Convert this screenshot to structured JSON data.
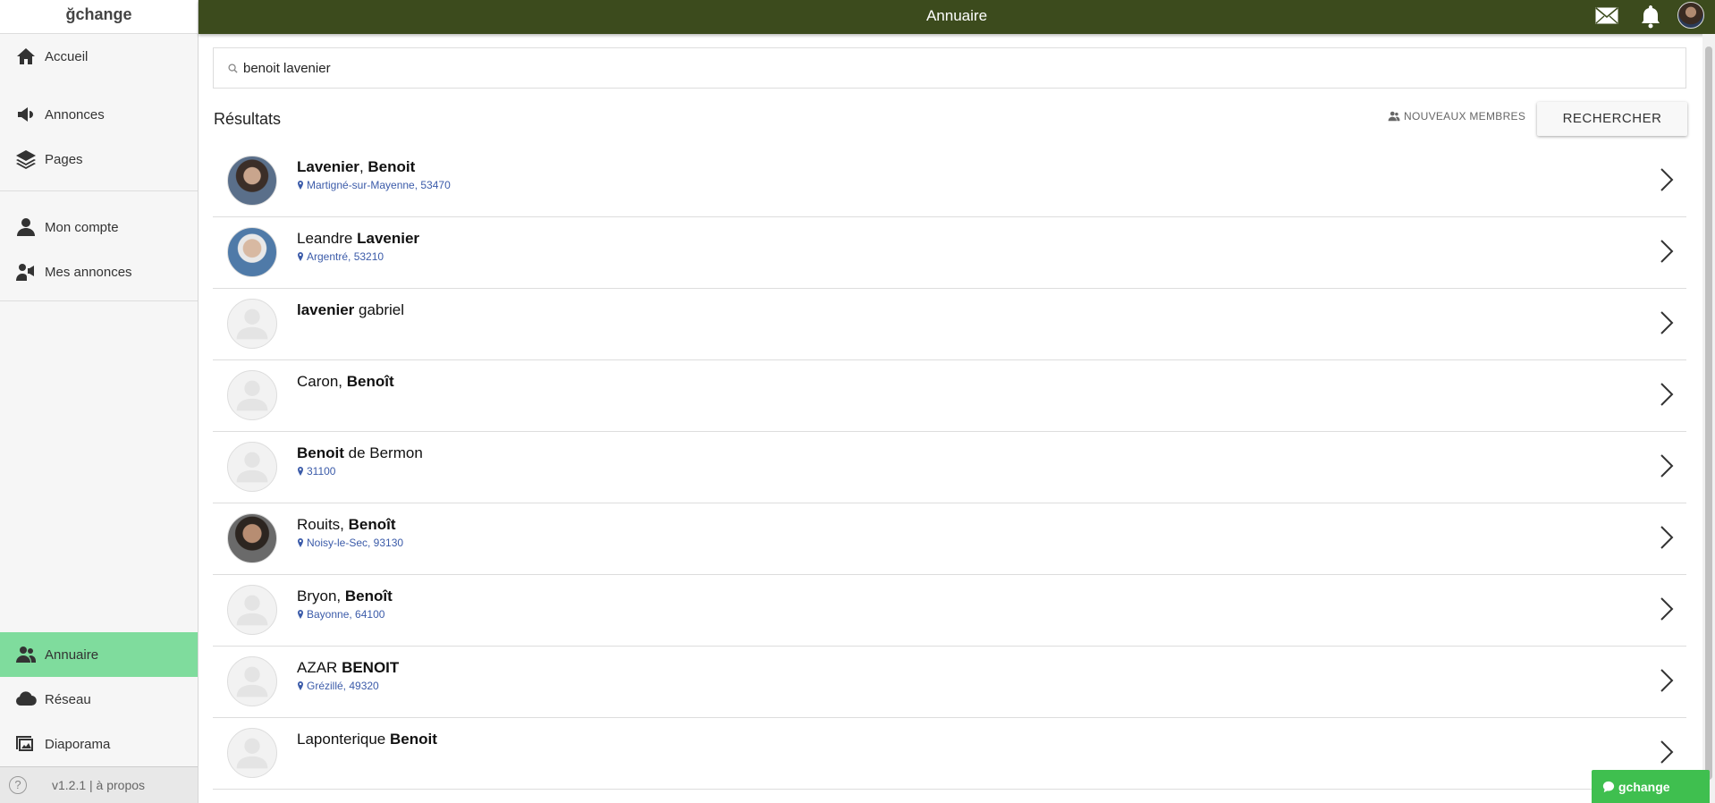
{
  "app": {
    "brand": "ğchange"
  },
  "sidebar": {
    "group1": [
      {
        "label": "Accueil",
        "icon": "home-icon"
      },
      {
        "label": "Annonces",
        "icon": "megaphone-icon"
      },
      {
        "label": "Pages",
        "icon": "layers-icon"
      }
    ],
    "group2": [
      {
        "label": "Mon compte",
        "icon": "person-icon"
      },
      {
        "label": "Mes annonces",
        "icon": "person-megaphone-icon"
      }
    ],
    "bottom": [
      {
        "label": "Annuaire",
        "icon": "people-icon",
        "active": true
      },
      {
        "label": "Réseau",
        "icon": "cloud-icon"
      },
      {
        "label": "Diaporama",
        "icon": "images-icon"
      }
    ],
    "footer": "v1.2.1 | à propos"
  },
  "topbar": {
    "title": "Annuaire"
  },
  "search": {
    "value": "benoit lavenier"
  },
  "results": {
    "heading": "Résultats",
    "new_members": "NOUVEAUX MEMBRES",
    "button": "RECHERCHER",
    "items": [
      {
        "parts": [
          {
            "t": "Lavenier",
            "b": true
          },
          {
            "t": ", ",
            "b": false
          },
          {
            "t": "Benoit",
            "b": true
          }
        ],
        "location": "Martigné-sur-Mayenne, 53470",
        "avatar": "photo1"
      },
      {
        "parts": [
          {
            "t": "Leandre ",
            "b": false
          },
          {
            "t": "Lavenier",
            "b": true
          }
        ],
        "location": "Argentré, 53210",
        "avatar": "photo2"
      },
      {
        "parts": [
          {
            "t": "lavenier",
            "b": true
          },
          {
            "t": " gabriel",
            "b": false
          }
        ],
        "location": "",
        "avatar": "placeholder"
      },
      {
        "parts": [
          {
            "t": "Caron, ",
            "b": false
          },
          {
            "t": "Benoît",
            "b": true
          }
        ],
        "location": "",
        "avatar": "placeholder"
      },
      {
        "parts": [
          {
            "t": "Benoit",
            "b": true
          },
          {
            "t": " de Bermon",
            "b": false
          }
        ],
        "location": "31100",
        "avatar": "placeholder"
      },
      {
        "parts": [
          {
            "t": "Rouits, ",
            "b": false
          },
          {
            "t": "Benoît",
            "b": true
          }
        ],
        "location": "Noisy-le-Sec, 93130",
        "avatar": "photo3"
      },
      {
        "parts": [
          {
            "t": "Bryon, ",
            "b": false
          },
          {
            "t": "Benoît",
            "b": true
          }
        ],
        "location": "Bayonne, 64100",
        "avatar": "placeholder"
      },
      {
        "parts": [
          {
            "t": "AZAR ",
            "b": false
          },
          {
            "t": "BENOIT",
            "b": true
          }
        ],
        "location": "Grézillé, 49320",
        "avatar": "placeholder"
      },
      {
        "parts": [
          {
            "t": "Laponterique ",
            "b": false
          },
          {
            "t": "Benoit",
            "b": true
          }
        ],
        "location": "",
        "avatar": "placeholder"
      }
    ]
  },
  "chat": {
    "label": "gchange"
  },
  "colors": {
    "topbar": "#3c4b1d",
    "active": "#7fdc9d",
    "location": "#3b5ba9",
    "chat": "#3fbf4f"
  }
}
